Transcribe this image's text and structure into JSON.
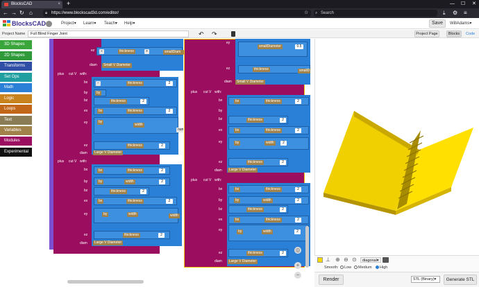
{
  "browser": {
    "tab_title": "BlocksCAD",
    "new_tab_icon": "plus-icon",
    "url": "https://www.blockscad3d.com/editor/",
    "search_placeholder": "Search"
  },
  "app": {
    "logo_text": "BlocksCAD",
    "menus": [
      {
        "label": "Project",
        "caret": "▾"
      },
      {
        "label": "Learn",
        "caret": "▾"
      },
      {
        "label": "Teach",
        "caret": "▾"
      },
      {
        "label": "Help",
        "caret": "▾"
      }
    ],
    "save_label": "Save",
    "user_label": "WillAdams",
    "user_caret": "▾"
  },
  "project_bar": {
    "name_label": "Project Name",
    "name_value": "Full Blind Finger Joint",
    "project_page_label": "Project Page",
    "blocks_label": "Blocks",
    "code_label": "Code"
  },
  "categories": [
    {
      "label": "3D Shapes",
      "color": "#3aa53a"
    },
    {
      "label": "2D Shapes",
      "color": "#2e9a3a"
    },
    {
      "label": "Transforms",
      "color": "#2f4ea6"
    },
    {
      "label": "Set Ops",
      "color": "#1f9f9f"
    },
    {
      "label": "Math",
      "color": "#2a7fd6"
    },
    {
      "label": "Logic",
      "color": "#c8821e"
    },
    {
      "label": "Loops",
      "color": "#c2671a"
    },
    {
      "label": "Text",
      "color": "#8a7c54"
    },
    {
      "label": "Variables",
      "color": "#a0824a"
    },
    {
      "label": "Modules",
      "color": "#9b0d5e"
    },
    {
      "label": "Experimental",
      "color": "#111111"
    }
  ],
  "blocks": {
    "plus": "plus",
    "cut": "cut V",
    "with": "with:",
    "bx": "bx",
    "by": "by",
    "bz": "bz",
    "ex": "ex",
    "ey": "ey",
    "ez": "ez",
    "diam": "diam",
    "thickness": "thickness",
    "width": "width",
    "smallDiameter": "smallDiameter",
    "smallDiameter_short": "smallDiam",
    "smallDiameter_trunc": "smallD",
    "num_trunc": "num",
    "two": "2",
    "half": "0.5",
    "small_v": "Small V Diameter",
    "large_v": "Large V Diameter",
    "op_mul": "×",
    "op_div": "÷",
    "op_minus": "−",
    "op_plus": "+",
    "caret": "▾"
  },
  "viewer": {
    "view_label": "diagonal",
    "smooth_label": "Smooth:",
    "low": "Low",
    "medium": "Medium",
    "high": "High",
    "selected_smooth": "High",
    "render_label": "Render",
    "format_value": "STL (Binary)",
    "generate_label": "Generate STL",
    "model_color": "#f5d800"
  }
}
